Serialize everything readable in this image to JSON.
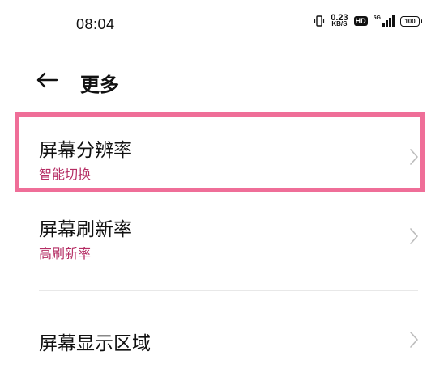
{
  "status_bar": {
    "time": "08:04",
    "net_speed_value": "0.23",
    "net_speed_unit": "KB/S",
    "hd_label": "HD",
    "network_type": "5G",
    "battery_level": "100"
  },
  "header": {
    "title": "更多"
  },
  "items": [
    {
      "title": "屏幕分辨率",
      "subtitle": "智能切换"
    },
    {
      "title": "屏幕刷新率",
      "subtitle": "高刷新率"
    },
    {
      "title": "屏幕显示区域"
    }
  ],
  "colors": {
    "subtitle_accent": "#b52d64",
    "highlight_border": "#ef6e98"
  },
  "icons": {
    "back": "arrow-left-icon",
    "chevron": "chevron-right-icon"
  }
}
